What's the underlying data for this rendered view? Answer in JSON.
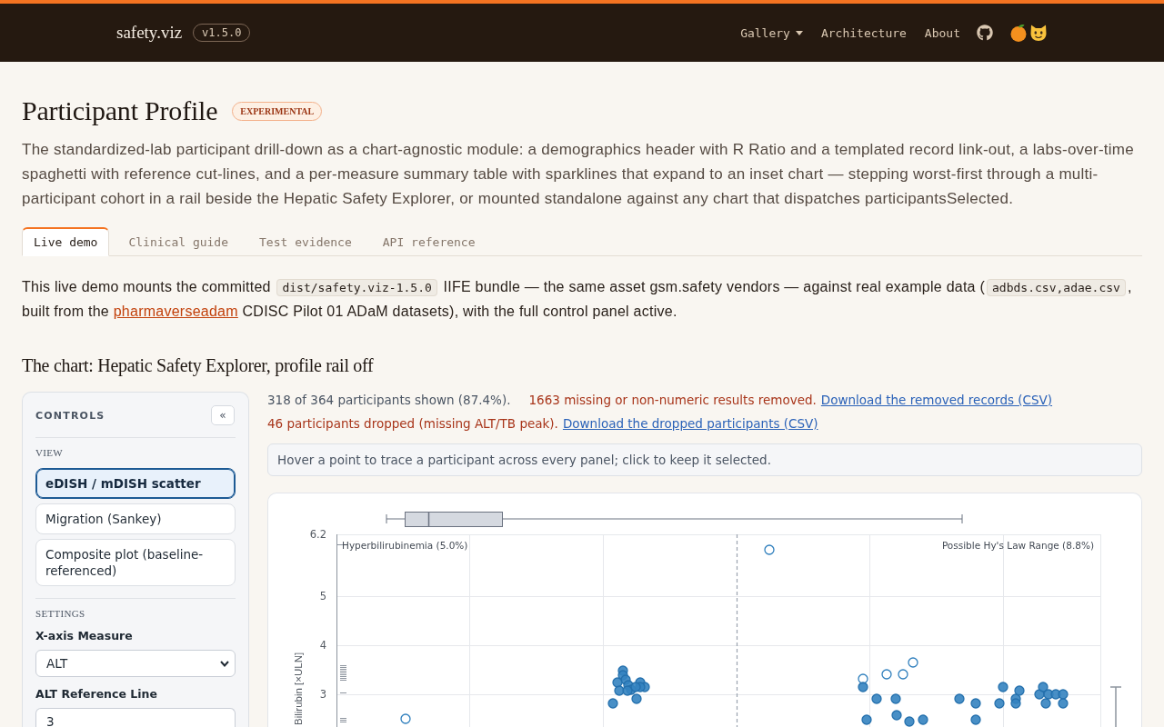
{
  "header": {
    "brand": "safety.viz",
    "version": "v1.5.0",
    "nav": [
      {
        "kind": "dropdown",
        "label": "Gallery"
      },
      {
        "kind": "link",
        "label": "Architecture"
      },
      {
        "kind": "link",
        "label": "About"
      },
      {
        "kind": "github"
      }
    ]
  },
  "page": {
    "title": "Participant Profile",
    "badge": "EXPERIMENTAL",
    "description": "The standardized-lab participant drill-down as a chart-agnostic module: a demographics header with R Ratio and a templated record link-out, a labs-over-time spaghetti with reference cut-lines, and a per-measure summary table with sparklines that expand to an inset chart — stepping worst-first through a multi-participant cohort in a rail beside the Hepatic Safety Explorer, or mounted standalone against any chart that dispatches participantsSelected."
  },
  "tabs": [
    {
      "label": "Live demo",
      "selected": true
    },
    {
      "label": "Clinical guide",
      "selected": false
    },
    {
      "label": "Test evidence",
      "selected": false
    },
    {
      "label": "API reference",
      "selected": false
    }
  ],
  "intro": [
    {
      "kind": "text",
      "text": "This live demo mounts the committed "
    },
    {
      "kind": "code",
      "text": "dist/safety.viz-1.5.0"
    },
    {
      "kind": "text",
      "text": " IIFE bundle — the same asset gsm.safety vendors — against real example data ("
    },
    {
      "kind": "code",
      "text": "adbds.csv,adae.csv"
    },
    {
      "kind": "text",
      "text": ", built from the "
    },
    {
      "kind": "link",
      "text": "pharmaverseadam"
    },
    {
      "kind": "text",
      "text": " CDISC Pilot 01 ADaM datasets), with the full control panel active."
    }
  ],
  "section_title": "The chart: Hepatic Safety Explorer, profile rail off",
  "controls": {
    "title": "CONTROLS",
    "collapse_label": "«",
    "view_label": "VIEW",
    "views": [
      {
        "label": "eDISH / mDISH scatter",
        "selected": true
      },
      {
        "label": "Migration (Sankey)",
        "selected": false
      },
      {
        "label": "Composite plot (baseline-referenced)",
        "selected": false
      }
    ],
    "settings_label": "SETTINGS",
    "settings": [
      {
        "kind": "select",
        "label": "X-axis Measure",
        "value": "ALT"
      },
      {
        "kind": "input",
        "label": "ALT Reference Line",
        "value": "3"
      }
    ]
  },
  "status": [
    [
      {
        "kind": "count",
        "text": "318 of 364 participants shown (87.4%)."
      },
      {
        "kind": "warning",
        "text": "1663 missing or non-numeric results removed."
      },
      {
        "kind": "link",
        "text": "Download the removed records (CSV)"
      }
    ],
    [
      {
        "kind": "warning",
        "text": "46 participants dropped (missing ALT/TB peak)."
      },
      {
        "kind": "link",
        "text": "Download the dropped participants (CSV)"
      }
    ]
  ],
  "hint": "Hover a point to trace a participant across every panel; click to keep it selected.",
  "chart": {
    "y_label": "Bilirubin [×ULN]",
    "y_tick_labels": [
      "6.2",
      "5",
      "4",
      "3"
    ],
    "annotations": [
      "Hyperbilirubinemia (5.0%)",
      "Possible Hy's Law Range (8.8%)"
    ]
  }
}
